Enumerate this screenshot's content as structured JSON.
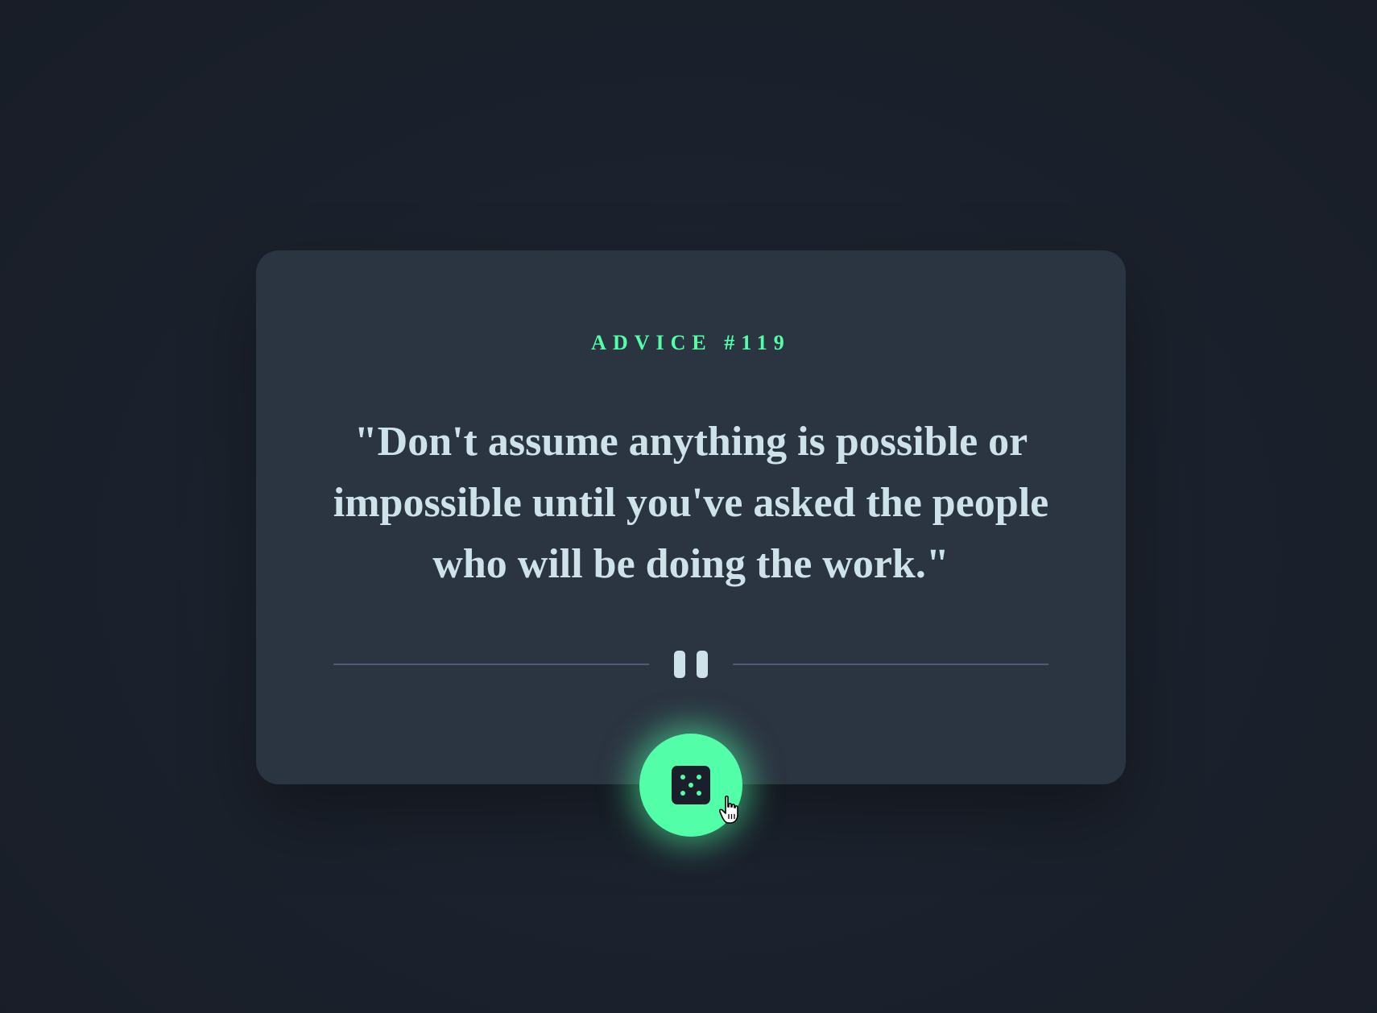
{
  "card": {
    "advice_label": "ADVICE #119",
    "quote": "\"Don't assume anything is possible or impossible until you've asked the people who will be doing the work.\""
  },
  "divider": {
    "icon": "pause-icon"
  },
  "button": {
    "icon": "dice-icon"
  },
  "colors": {
    "accent": "#52ffa8",
    "text": "#cee3e9",
    "card": "#2b3441",
    "background": "#1a202b"
  }
}
